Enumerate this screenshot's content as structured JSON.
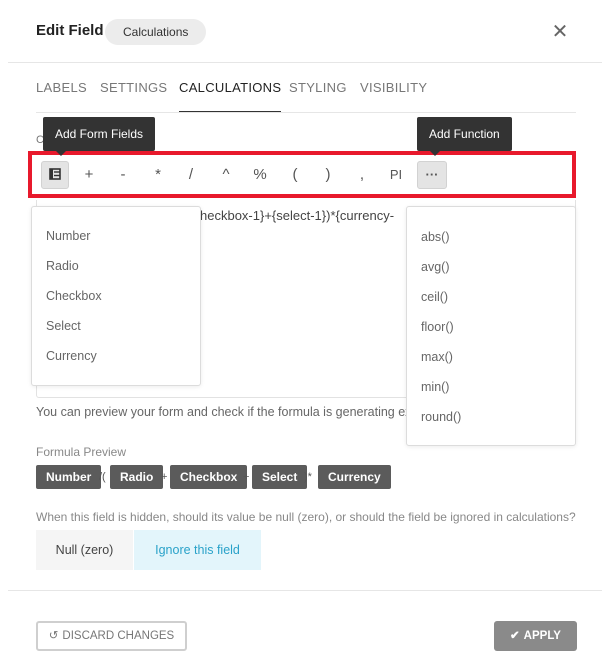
{
  "header": {
    "title": "Edit Field",
    "badge": "Calculations",
    "close_glyph": "✕"
  },
  "tabs": [
    {
      "label": "LABELS"
    },
    {
      "label": "SETTINGS"
    },
    {
      "label": "CALCULATIONS",
      "active": true
    },
    {
      "label": "STYLING"
    },
    {
      "label": "VISIBILITY"
    }
  ],
  "calculation_label": "C",
  "toolbar": {
    "form_fields_icon": "list-icon",
    "operators": [
      "+",
      "-",
      "*",
      "/",
      "^",
      "%",
      "(",
      ")",
      ","
    ],
    "pi_label": "PI",
    "more_label": "···",
    "highlight_color": "#e8192c"
  },
  "tooltips": {
    "add_form_fields": "Add Form Fields",
    "add_function": "Add Function"
  },
  "formula": {
    "visible_text": "heckbox-1}+{select-1})*{currency-"
  },
  "form_fields_menu": [
    "Number",
    "Radio",
    "Checkbox",
    "Select",
    "Currency"
  ],
  "functions_menu": [
    "abs()",
    "avg()",
    "ceil()",
    "floor()",
    "max()",
    "min()",
    "round()"
  ],
  "help_text": "You can preview your form and check if the formula is generating ex",
  "preview": {
    "label": "Formula Preview",
    "chips": [
      "Number",
      "Radio",
      "Checkbox",
      "Select",
      "Currency"
    ],
    "operators": [
      "/(",
      "+",
      "+",
      ")*"
    ]
  },
  "hidden_question": "When this field is hidden, should its value be null (zero), or should the field be ignored in calculations?",
  "hidden_options": {
    "null_label": "Null (zero)",
    "ignore_label": "Ignore this field",
    "selected": "ignore"
  },
  "footer": {
    "discard_icon": "↺",
    "discard_label": "DISCARD CHANGES",
    "apply_icon": "✔",
    "apply_label": "APPLY"
  },
  "colors": {
    "accent": "#2aa2c9",
    "chip": "#5b5b5b",
    "apply_bg": "#8a8a8a"
  }
}
